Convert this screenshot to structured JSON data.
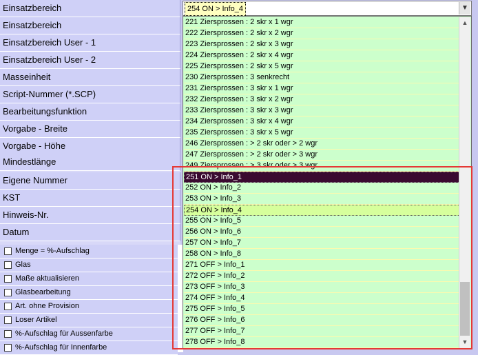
{
  "labels": [
    "Einsatzbereich",
    "Einsatzbereich",
    "Einsatzbereich User - 1",
    "Einsatzbereich User - 2",
    "Masseinheit",
    "Script-Nummer (*.SCP)",
    "Bearbeitungsfunktion",
    "Vorgabe - Breite",
    "Vorgabe - Höhe",
    "Mindestlänge",
    "Eigene Nummer",
    "KST",
    "Hinweis-Nr.",
    "Datum"
  ],
  "checkboxes": [
    {
      "label": "Menge = %-Aufschlag",
      "checked": false
    },
    {
      "label": "Glas",
      "checked": false
    },
    {
      "label": "Maße aktualisieren",
      "checked": false
    },
    {
      "label": "Glasbearbeitung",
      "checked": false
    },
    {
      "label": "Art. ohne Provision",
      "checked": false
    },
    {
      "label": "Loser Artikel",
      "checked": false
    },
    {
      "label": "%-Aufschlag für Aussenfarbe",
      "checked": false
    },
    {
      "label": "%-Aufschlag für Innenfarbe",
      "checked": false
    }
  ],
  "combo": {
    "value": "254 ON  > Info_4",
    "arrow": "chevron-down"
  },
  "list_items": [
    "221 Ziersprossen : 2 skr x 1 wgr",
    "222 Ziersprossen : 2 skr x 2 wgr",
    "223 Ziersprossen : 2 skr x 3 wgr",
    "224 Ziersprossen : 2 skr x 4 wgr",
    "225 Ziersprossen : 2 skr x 5 wgr",
    "230 Ziersprossen : 3 senkrecht",
    "231 Ziersprossen : 3 skr x 1 wgr",
    "232 Ziersprossen : 3 skr x 2 wgr",
    "233 Ziersprossen : 3 skr x 3 wgr",
    "234 Ziersprossen : 3 skr x 4 wgr",
    "235 Ziersprossen : 3 skr x 5 wgr",
    "246 Ziersprossen : > 2 skr oder > 2 wgr",
    "247 Ziersprossen : > 2 skr oder > 3 wgr",
    "249 Ziersprossen : > 3 skr oder > 3 wgr",
    "251 ON  > Info_1",
    "252 ON  > Info_2",
    "253 ON  > Info_3",
    "254 ON  > Info_4",
    "255 ON  > Info_5",
    "256 ON  > Info_6",
    "257 ON  > Info_7",
    "258 ON  > Info_8",
    "271 OFF > Info_1",
    "272 OFF > Info_2",
    "273 OFF > Info_3",
    "274 OFF > Info_4",
    "275 OFF > Info_5",
    "276 OFF > Info_6",
    "277 OFF > Info_7",
    "278 OFF > Info_8"
  ],
  "selected_index": 14,
  "current_index": 17,
  "colors": {
    "list_bg": "#ccffcc",
    "selected_bg": "#3a0a30",
    "current_bg": "#d6ff9c",
    "highlight_border": "#e53935",
    "label_bg": "#cfd0f7"
  },
  "scroll_icons": {
    "up": "chevron-up",
    "down": "chevron-down"
  }
}
